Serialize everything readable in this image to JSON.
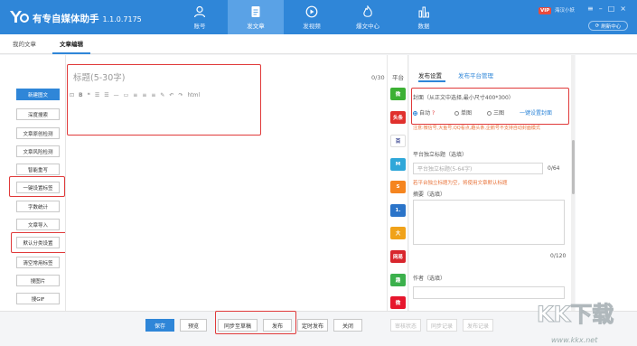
{
  "app": {
    "title": "有专自媒体助手",
    "version": "1.1.0.7175"
  },
  "nav": [
    {
      "label": "账号",
      "icon": "user-icon"
    },
    {
      "label": "发文章",
      "icon": "document-icon"
    },
    {
      "label": "发视频",
      "icon": "play-icon"
    },
    {
      "label": "爆文中心",
      "icon": "fire-icon"
    },
    {
      "label": "数据",
      "icon": "chart-icon"
    }
  ],
  "user": {
    "vip": "VIP",
    "name": "海汉小妖",
    "refresh": "刷新中心"
  },
  "tabs": [
    "我的文章",
    "文章编辑"
  ],
  "left_tools": [
    "新建图文",
    "深度搜索",
    "文章原创检测",
    "文章风险检测",
    "智能重写",
    "一键设置标签",
    "字数统计",
    "文章导入",
    "默认分类设置",
    "清空常用标签",
    "搜图片",
    "搜GIF"
  ],
  "editor": {
    "title_placeholder": "标题(5-30字)",
    "title_count": "0/30",
    "toolbar_end": "html"
  },
  "platforms": {
    "label": "平台",
    "icons": [
      {
        "name": "wechat-icon",
        "text": "微",
        "color": "#3cb034"
      },
      {
        "name": "toutiao-icon",
        "text": "头条",
        "color": "#e0302d"
      },
      {
        "name": "baijiahao-icon",
        "text": "百",
        "color": "#ffffff"
      },
      {
        "name": "yidian-icon",
        "text": "M",
        "color": "#2fa7d9"
      },
      {
        "name": "sohu-icon",
        "text": "S",
        "color": "#f5851f"
      },
      {
        "name": "yiqi-icon",
        "text": "1.",
        "color": "#2b74c9"
      },
      {
        "name": "dayu-icon",
        "text": "大",
        "color": "#f0a21a"
      },
      {
        "name": "wangyi-icon",
        "text": "网易",
        "color": "#d8262d"
      },
      {
        "name": "qutoutiao-icon",
        "text": "趣",
        "color": "#3bb04c"
      },
      {
        "name": "weibo-icon",
        "text": "微",
        "color": "#e6162d"
      }
    ]
  },
  "settings": {
    "tabs": [
      "发布设置",
      "发布平台管理"
    ],
    "cover_label": "封面（从正文中选择,最小尺寸400*300）",
    "cover_options": [
      "自动",
      "单图",
      "三图"
    ],
    "cover_link": "一键设置封面",
    "cover_warning": "注意:微信号,大鱼号,QQ看点,趣头条,企鹅号不支持自动封面模式",
    "standalone_title_label": "平台独立标题（选填）",
    "standalone_title_placeholder": "平台独立标题(5-64字)",
    "standalone_title_count": "0/64",
    "standalone_title_warning": "若平台独立标题为空，将使用文章默认标题",
    "summary_label": "摘要（选填）",
    "summary_count": "0/120",
    "author_label": "作者（选填）"
  },
  "bottom": {
    "buttons": [
      "保存",
      "预览",
      "同步至草稿",
      "发布",
      "定时发布",
      "关闭"
    ],
    "disabled_buttons": [
      "审核状态",
      "同步记录",
      "发布记录"
    ]
  },
  "watermark": {
    "logo": "KK下载",
    "url": "www.kkx.net"
  }
}
